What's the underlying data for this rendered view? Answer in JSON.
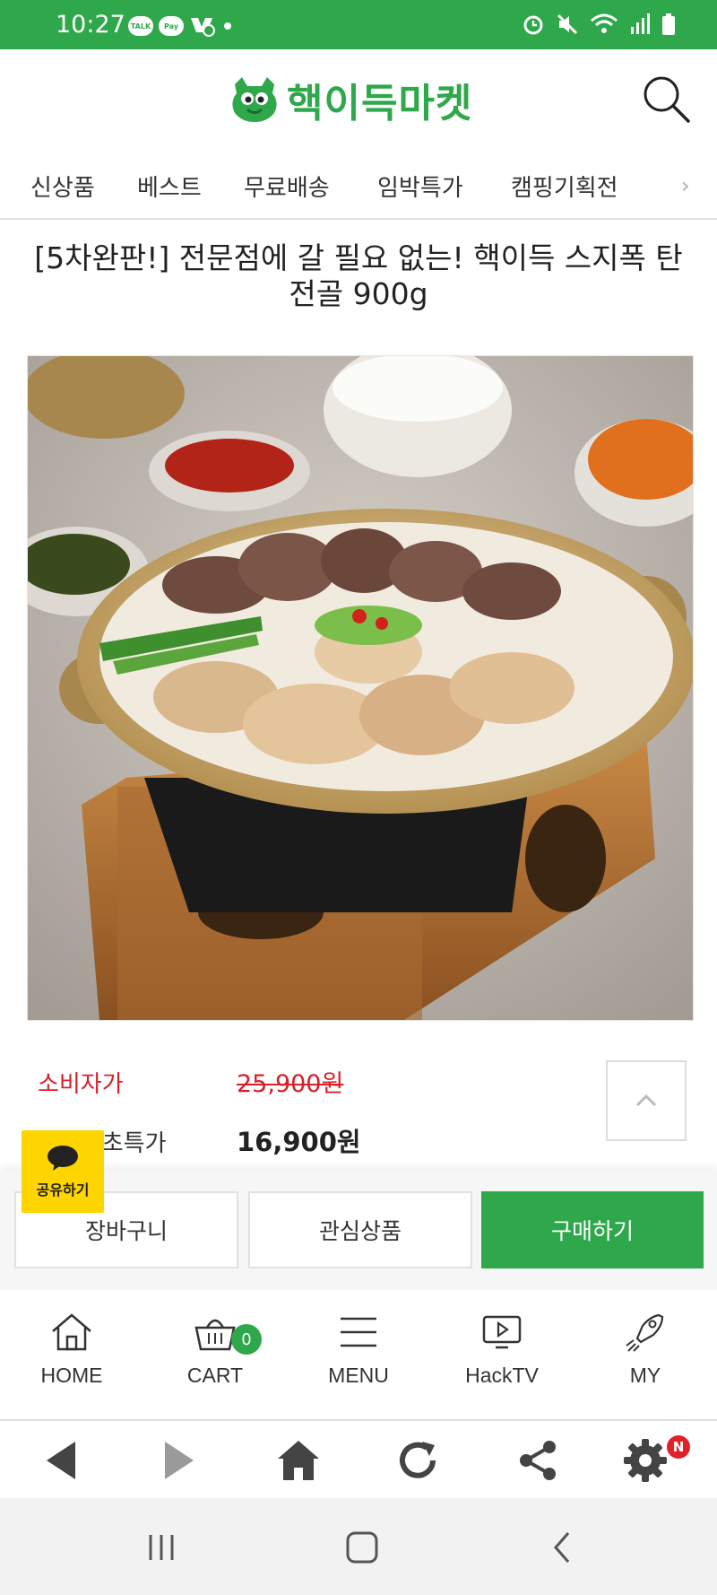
{
  "status_bar": {
    "time": "10:27",
    "icons": [
      "talk-icon",
      "pay-icon",
      "notification-icon",
      "dot-icon",
      "alarm-icon",
      "mute-icon",
      "wifi-icon",
      "signal-icon",
      "battery-icon"
    ],
    "talk_label": "TALK",
    "pay_label": "Pay"
  },
  "header": {
    "brand": "핵이득마켓"
  },
  "nav": {
    "items": [
      "신상품",
      "베스트",
      "무료배송",
      "임박특가",
      "캠핑기획전"
    ]
  },
  "product": {
    "title": "[5차완판!] 전문점에 갈 필요 없는! 핵이득 스지폭 탄전골 900g",
    "price_label": "소비자가",
    "original_price": "25,900원",
    "sale_label": "핵이득초특가",
    "sale_price": "16,900원"
  },
  "share": {
    "label": "공유하기"
  },
  "actions": {
    "cart": "장바구니",
    "wishlist": "관심상품",
    "buy": "구매하기"
  },
  "bottom_nav": {
    "items": [
      {
        "label": "HOME"
      },
      {
        "label": "CART"
      },
      {
        "label": "MENU"
      },
      {
        "label": "HackTV"
      },
      {
        "label": "MY"
      }
    ],
    "cart_count": "0"
  },
  "browser": {
    "settings_badge": "N"
  },
  "colors": {
    "brand_green": "#2ea84a",
    "price_red": "#d6202a",
    "share_yellow": "#ffd500"
  }
}
